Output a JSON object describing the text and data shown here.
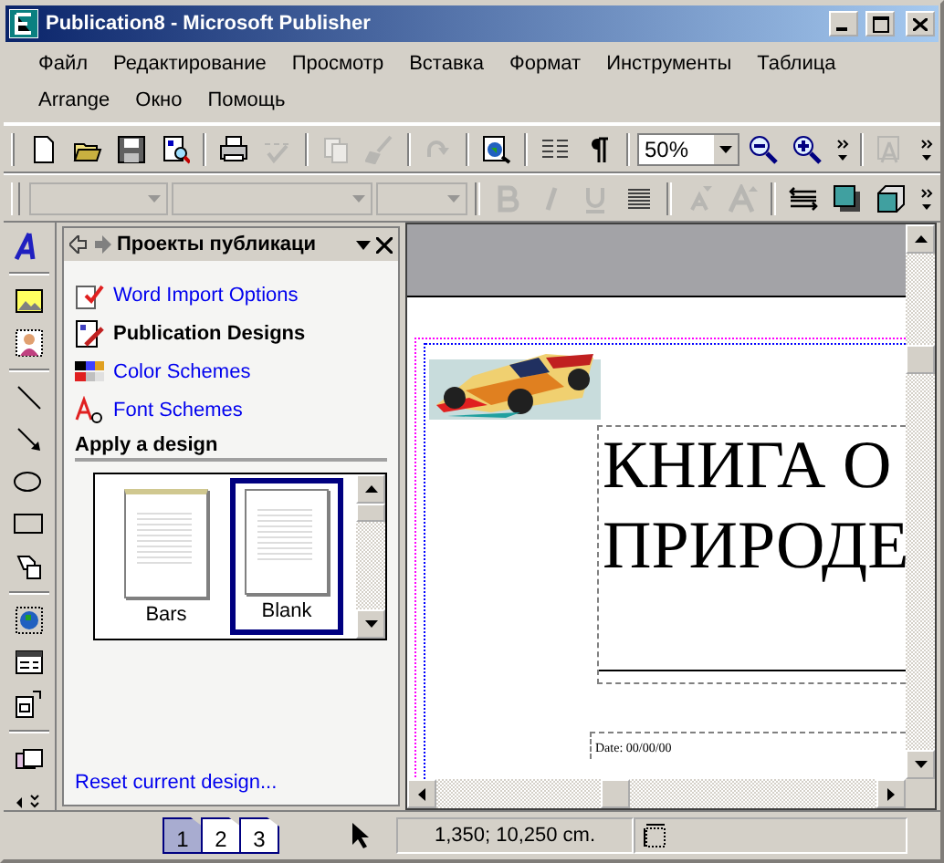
{
  "window": {
    "title": "Publication8 - Microsoft Publisher"
  },
  "menu": [
    "Файл",
    "Редактирование",
    "Просмотр",
    "Вставка",
    "Формат",
    "Инструменты",
    "Таблица",
    "Arrange",
    "Окно",
    "Помощь"
  ],
  "standard_toolbar": [
    {
      "kind": "new",
      "disabled": false
    },
    {
      "kind": "open",
      "disabled": false
    },
    {
      "kind": "save",
      "disabled": false
    },
    {
      "kind": "preview",
      "disabled": false
    },
    {
      "kind": "sep"
    },
    {
      "kind": "print",
      "disabled": false
    },
    {
      "kind": "spell",
      "disabled": true
    },
    {
      "kind": "sep"
    },
    {
      "kind": "copy",
      "disabled": true
    },
    {
      "kind": "brush",
      "disabled": true
    },
    {
      "kind": "sep"
    },
    {
      "kind": "redo",
      "disabled": true
    },
    {
      "kind": "sep"
    },
    {
      "kind": "webpreview",
      "disabled": false
    },
    {
      "kind": "sep"
    },
    {
      "kind": "columns",
      "disabled": false
    },
    {
      "kind": "pilcrow",
      "disabled": false
    },
    {
      "kind": "sep"
    },
    {
      "kind": "zoom"
    },
    {
      "kind": "zoomout",
      "disabled": false
    },
    {
      "kind": "zoomin",
      "disabled": false
    },
    {
      "kind": "more",
      "disabled": false
    },
    {
      "kind": "sep"
    },
    {
      "kind": "textframe",
      "disabled": true
    },
    {
      "kind": "more",
      "disabled": false
    }
  ],
  "zoom": {
    "value": "50%"
  },
  "formatting_toolbar": [
    {
      "kind": "combo-wide",
      "disabled": true
    },
    {
      "kind": "combo-wider",
      "disabled": true
    },
    {
      "kind": "combo",
      "disabled": true
    },
    {
      "kind": "sep"
    },
    {
      "kind": "bold",
      "disabled": true
    },
    {
      "kind": "italic",
      "disabled": true
    },
    {
      "kind": "underline",
      "disabled": true
    },
    {
      "kind": "align",
      "disabled": false
    },
    {
      "kind": "sep"
    },
    {
      "kind": "shrink",
      "disabled": true
    },
    {
      "kind": "grow",
      "disabled": true
    },
    {
      "kind": "sep"
    },
    {
      "kind": "linestyle",
      "disabled": false
    },
    {
      "kind": "shadow",
      "disabled": false
    },
    {
      "kind": "threed",
      "disabled": false
    },
    {
      "kind": "more",
      "disabled": false
    }
  ],
  "tools": [
    {
      "kind": "design"
    },
    {
      "kind": "sep"
    },
    {
      "kind": "picture"
    },
    {
      "kind": "clipart"
    },
    {
      "kind": "sep"
    },
    {
      "kind": "line"
    },
    {
      "kind": "arrow"
    },
    {
      "kind": "oval"
    },
    {
      "kind": "rect"
    },
    {
      "kind": "autoshape"
    },
    {
      "kind": "sep"
    },
    {
      "kind": "web"
    },
    {
      "kind": "form"
    },
    {
      "kind": "object"
    },
    {
      "kind": "sep"
    },
    {
      "kind": "design-gallery"
    },
    {
      "kind": "spacer"
    },
    {
      "kind": "chevrons"
    }
  ],
  "task_pane": {
    "title": "Проекты публикаци",
    "links": [
      {
        "label": "Word Import Options",
        "kind": "import",
        "selected": false
      },
      {
        "label": "Publication Designs",
        "kind": "designs",
        "selected": true
      },
      {
        "label": "Color Schemes",
        "kind": "colors",
        "selected": false
      },
      {
        "label": "Font Schemes",
        "kind": "fonts",
        "selected": false
      }
    ],
    "section": "Apply a design",
    "designs": [
      {
        "label": "Bars",
        "kind": "bars",
        "selected": false
      },
      {
        "label": "Blank",
        "kind": "blank",
        "selected": true
      }
    ],
    "reset_link": "Reset current design..."
  },
  "document": {
    "title_lines": [
      "КНИГА О",
      "ПРИРОДЕ"
    ],
    "date": "Date: 00/00/00",
    "picture": {
      "kind": "picture"
    }
  },
  "status_bar": {
    "pages": [
      {
        "label": "1",
        "selected": true
      },
      {
        "label": "2",
        "selected": false
      },
      {
        "label": "3",
        "selected": false
      }
    ],
    "position": "1,350; 10,250 cm."
  }
}
